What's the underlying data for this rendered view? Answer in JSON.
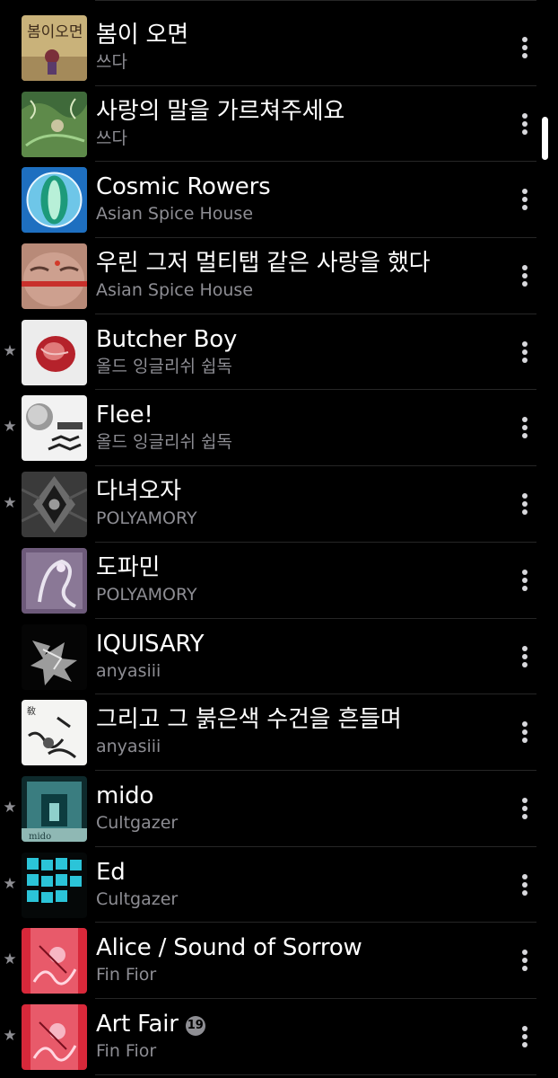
{
  "songs": [
    {
      "title": "봄이 오면",
      "artist": "쓰다",
      "starred": false,
      "explicit": false,
      "art_icon": "spring-album-art"
    },
    {
      "title": "사랑의 말을 가르쳐주세요",
      "artist": "쓰다",
      "starred": false,
      "explicit": false,
      "art_icon": "green-forest-album-art"
    },
    {
      "title": "Cosmic Rowers",
      "artist": "Asian Spice House",
      "starred": false,
      "explicit": false,
      "art_icon": "blue-mandala-album-art"
    },
    {
      "title": "우린 그저 멀티탭 같은 사랑을 했다",
      "artist": "Asian Spice House",
      "starred": false,
      "explicit": false,
      "art_icon": "face-closeup-album-art"
    },
    {
      "title": "Butcher Boy",
      "artist": "올드 잉글리쉬 쉽독",
      "starred": true,
      "explicit": false,
      "art_icon": "red-meat-album-art"
    },
    {
      "title": "Flee!",
      "artist": "올드 잉글리쉬 쉽독",
      "starred": true,
      "explicit": false,
      "art_icon": "moon-sketch-album-art"
    },
    {
      "title": "다녀오자",
      "artist": "POLYAMORY",
      "starred": true,
      "explicit": false,
      "art_icon": "symmetric-gray-album-art"
    },
    {
      "title": "도파민",
      "artist": "POLYAMORY",
      "starred": false,
      "explicit": false,
      "art_icon": "purple-figure-album-art"
    },
    {
      "title": "IQUISARY",
      "artist": "anyasiii",
      "starred": false,
      "explicit": false,
      "art_icon": "silver-chrome-album-art"
    },
    {
      "title": "그리고 그 붉은색 수건을 흔들며",
      "artist": "anyasiii",
      "starred": false,
      "explicit": false,
      "art_icon": "ink-sketch-album-art"
    },
    {
      "title": "mido",
      "artist": "Cultgazer",
      "starred": true,
      "explicit": false,
      "art_icon": "teal-corridor-album-art"
    },
    {
      "title": "Ed",
      "artist": "Cultgazer",
      "starred": true,
      "explicit": false,
      "art_icon": "cyan-grid-album-art"
    },
    {
      "title": "Alice / Sound of Sorrow",
      "artist": "Fin Fior",
      "starred": true,
      "explicit": false,
      "art_icon": "red-pink-album-art"
    },
    {
      "title": "Art Fair",
      "artist": "Fin Fior",
      "starred": true,
      "explicit": true,
      "explicit_label": "19",
      "art_icon": "red-pink-album-art"
    }
  ],
  "star_glyph": "★",
  "colors": {
    "background": "#000000",
    "title": "#ffffff",
    "subtitle": "#8d8d93",
    "separator": "#262626",
    "star": "#8e8e93",
    "more_dots": "#d8d8dc",
    "scroll_indicator": "#ffffff"
  },
  "icons": {
    "row_action": "more-vertical-icon",
    "favorite": "star-icon",
    "explicit": "age-19-badge-icon"
  }
}
